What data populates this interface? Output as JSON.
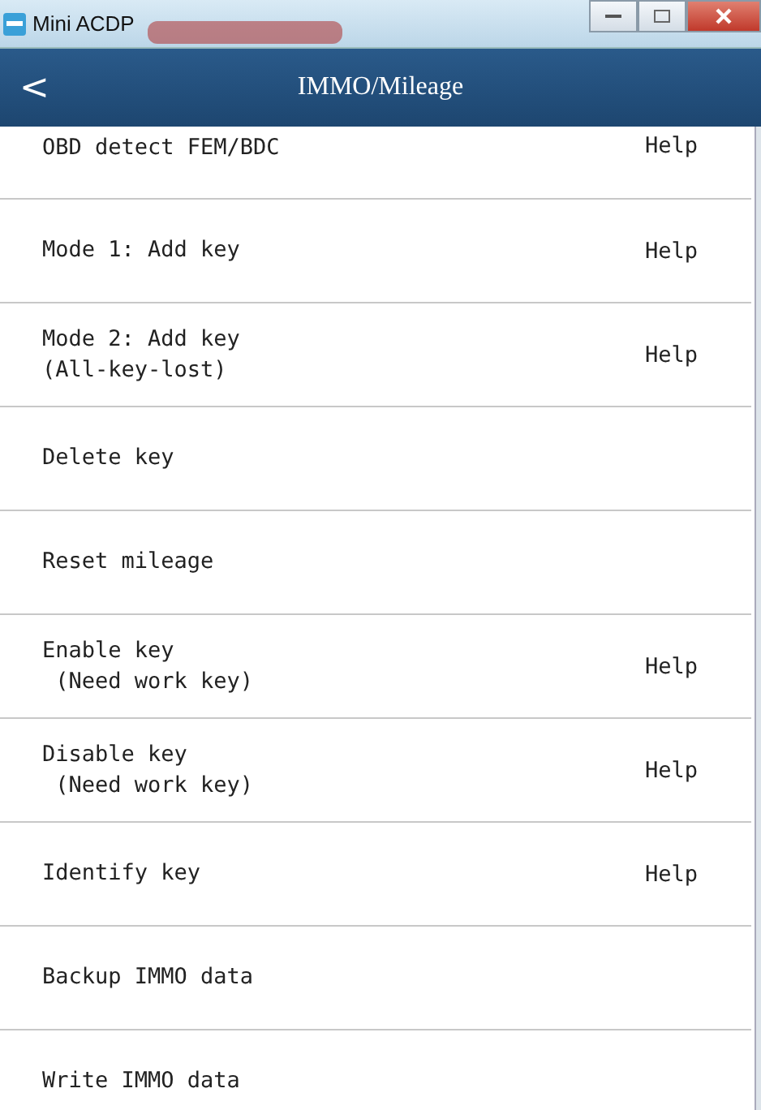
{
  "window": {
    "title": "Mini ACDP"
  },
  "header": {
    "back": "<",
    "title": "IMMO/Mileage"
  },
  "items": [
    {
      "lines": [
        "OBD detect FEM/BDC"
      ],
      "help": "Help"
    },
    {
      "lines": [
        "Mode 1: Add key"
      ],
      "help": "Help"
    },
    {
      "lines": [
        "Mode 2: Add key",
        "(All-key-lost)"
      ],
      "help": "Help"
    },
    {
      "lines": [
        "Delete key"
      ]
    },
    {
      "lines": [
        "Reset mileage"
      ]
    },
    {
      "lines": [
        "Enable key",
        " (Need work key)"
      ],
      "help": "Help"
    },
    {
      "lines": [
        "Disable key",
        " (Need work key)"
      ],
      "help": "Help"
    },
    {
      "lines": [
        "Identify key"
      ],
      "help": "Help"
    },
    {
      "lines": [
        "Backup IMMO data"
      ]
    },
    {
      "lines": [
        "Write IMMO data"
      ]
    }
  ]
}
